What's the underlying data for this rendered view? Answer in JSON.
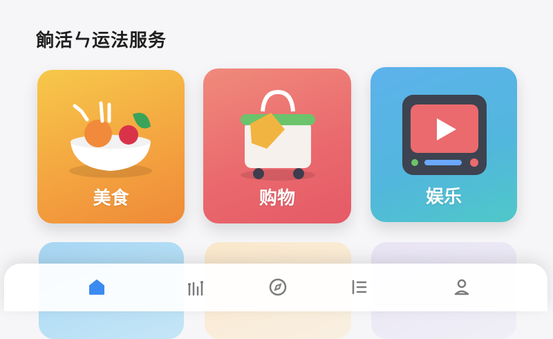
{
  "header": {
    "title": "餉活ㄣ运法服务"
  },
  "tiles": [
    {
      "label": "美食",
      "icon": "food-bowl-icon",
      "color": "#f4a540"
    },
    {
      "label": "购物",
      "icon": "shopping-basket-icon",
      "color": "#ea6a6e"
    },
    {
      "label": "娱乐",
      "icon": "video-player-icon",
      "color": "#52b7dc"
    }
  ],
  "tabbar": {
    "items": [
      {
        "icon": "home-icon",
        "active": true
      },
      {
        "icon": "activity-icon",
        "active": false
      },
      {
        "icon": "compass-icon",
        "active": false
      },
      {
        "icon": "list-icon",
        "active": false
      },
      {
        "icon": "profile-icon",
        "active": false
      }
    ],
    "active_color": "#3b8bf0",
    "inactive_color": "#7a7a7a"
  }
}
